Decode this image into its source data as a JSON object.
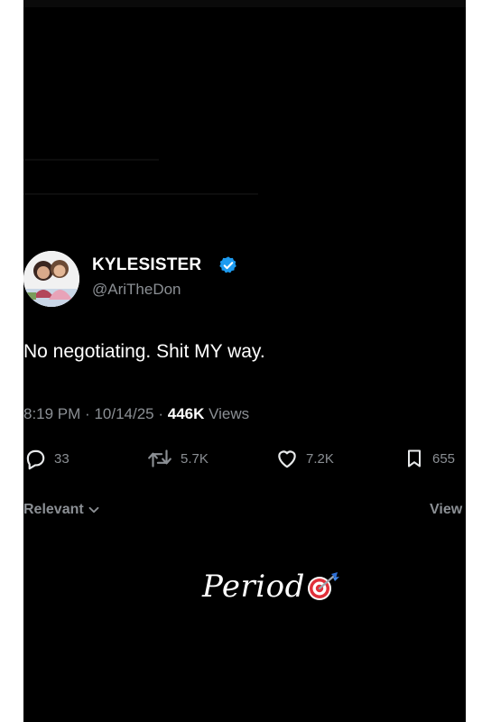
{
  "tweet": {
    "display_name": "KYLESISTER",
    "handle": "@AriTheDon",
    "text": "No negotiating. Shit MY way.",
    "time": "8:19 PM",
    "date": "10/14/25",
    "views_count": "446K",
    "views_label": "Views",
    "replies": "33",
    "retweets": "5.7K",
    "likes": "7.2K",
    "bookmarks": "655"
  },
  "replies_bar": {
    "sort_label": "Relevant",
    "view_label": "View"
  },
  "caption": {
    "text": "Period",
    "emoji": "🎯"
  },
  "colors": {
    "background": "#000000",
    "text": "#ffffff",
    "muted": "#8b8f94",
    "verified": "#1d9bf0"
  },
  "icons": {
    "verified": "verified-badge-icon",
    "reply": "reply-icon",
    "retweet": "retweet-icon",
    "like": "heart-icon",
    "bookmark": "bookmark-icon",
    "sort": "chevron-down-icon",
    "caption": "bullseye-dart-icon"
  }
}
